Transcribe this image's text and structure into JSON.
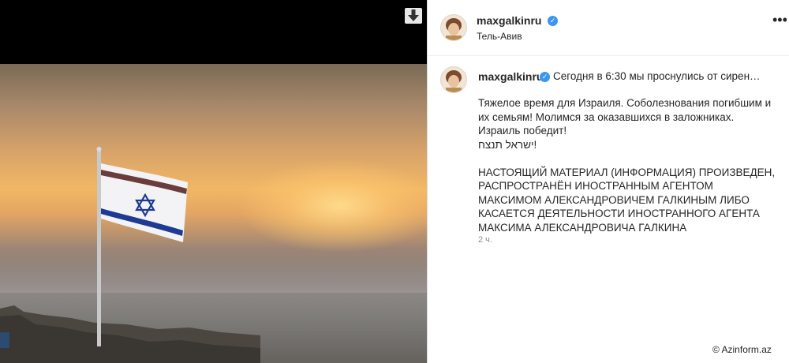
{
  "post": {
    "username": "maxgalkinru",
    "location": "Тель-Авив",
    "caption_preview": "Сегодня в 6:30 мы проснулись от сирен…",
    "caption_lines": [
      "Тяжелое время для Израиля. Соболезнования погибшим и их семьям! Молимся за оказавшихся в заложниках.",
      "Израиль победит!",
      "!ישראל תנצח"
    ],
    "disclaimer": "НАСТОЯЩИЙ МАТЕРИАЛ (ИНФОРМАЦИЯ) ПРОИЗВЕДЕН, РАСПРОСТРАНЁН ИНОСТРАННЫМ АГЕНТОМ МАКСИМОМ АЛЕКСАНДРОВИЧЕМ ГАЛКИНЫМ ЛИБО КАСАЕТСЯ ДЕЯТЕЛЬНОСТИ ИНОСТРАННОГО АГЕНТА МАКСИМА АЛЕКСАНДРОВИЧА ГАЛКИНА",
    "time": "2 ч.",
    "more_icon": "ellipsis-icon",
    "verified_icon": "verified-badge-icon"
  },
  "media": {
    "download_icon": "download-arrow-icon",
    "alt_subject": "israeli-flag-sunset-photo"
  },
  "watermark": "© Azinform.az",
  "colors": {
    "verified": "#3897f0",
    "text": "#262626",
    "muted": "#8e8e8e",
    "flag_blue": "#1f3a93"
  }
}
